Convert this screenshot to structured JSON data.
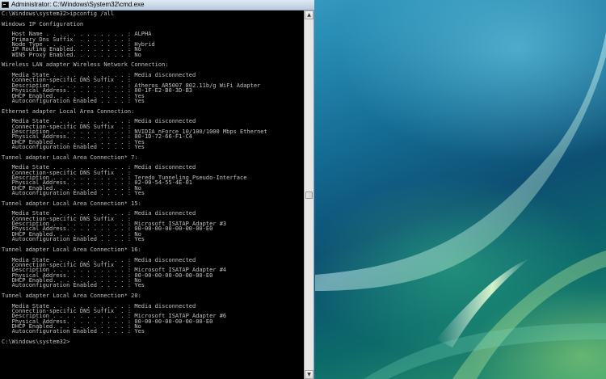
{
  "window": {
    "title": "Administrator: C:\\Windows\\System32\\cmd.exe"
  },
  "console": {
    "lines": [
      "C:\\Windows\\system32>ipconfig /all",
      "",
      "Windows IP Configuration",
      "",
      "   Host Name . . . . . . . . . . . . : ALPHA",
      "   Primary Dns Suffix  . . . . . . . :",
      "   Node Type . . . . . . . . . . . . : Hybrid",
      "   IP Routing Enabled. . . . . . . . : No",
      "   WINS Proxy Enabled. . . . . . . . : No",
      "",
      "Wireless LAN adapter Wireless Network Connection:",
      "",
      "   Media State . . . . . . . . . . . : Media disconnected",
      "   Connection-specific DNS Suffix  . :",
      "   Description . . . . . . . . . . . : Atheros AR5007 802.11b/g WiFi Adapter",
      "   Physical Address. . . . . . . . . : 00-1F-E2-B0-3D-B3",
      "   DHCP Enabled. . . . . . . . . . . : Yes",
      "   Autoconfiguration Enabled . . . . : Yes",
      "",
      "Ethernet adapter Local Area Connection:",
      "",
      "   Media State . . . . . . . . . . . : Media disconnected",
      "   Connection-specific DNS Suffix  . :",
      "   Description . . . . . . . . . . . : NVIDIA nForce 10/100/1000 Mbps Ethernet",
      "   Physical Address. . . . . . . . . : 00-1D-72-66-F1-C4",
      "   DHCP Enabled. . . . . . . . . . . : Yes",
      "   Autoconfiguration Enabled . . . . : Yes",
      "",
      "Tunnel adapter Local Area Connection* 7:",
      "",
      "   Media State . . . . . . . . . . . : Media disconnected",
      "   Connection-specific DNS Suffix  . :",
      "   Description . . . . . . . . . . . : Teredo Tunneling Pseudo-Interface",
      "   Physical Address. . . . . . . . . : 02-00-54-55-4E-01",
      "   DHCP Enabled. . . . . . . . . . . : No",
      "   Autoconfiguration Enabled . . . . : Yes",
      "",
      "Tunnel adapter Local Area Connection* 15:",
      "",
      "   Media State . . . . . . . . . . . : Media disconnected",
      "   Connection-specific DNS Suffix  . :",
      "   Description . . . . . . . . . . . : Microsoft ISATAP Adapter #3",
      "   Physical Address. . . . . . . . . : 00-00-00-00-00-00-00-E0",
      "   DHCP Enabled. . . . . . . . . . . : No",
      "   Autoconfiguration Enabled . . . . : Yes",
      "",
      "Tunnel adapter Local Area Connection* 16:",
      "",
      "   Media State . . . . . . . . . . . : Media disconnected",
      "   Connection-specific DNS Suffix  . :",
      "   Description . . . . . . . . . . . : Microsoft ISATAP Adapter #4",
      "   Physical Address. . . . . . . . . : 00-00-00-00-00-00-00-E0",
      "   DHCP Enabled. . . . . . . . . . . : No",
      "   Autoconfiguration Enabled . . . . : Yes",
      "",
      "Tunnel adapter Local Area Connection* 20:",
      "",
      "   Media State . . . . . . . . . . . : Media disconnected",
      "   Connection-specific DNS Suffix  . :",
      "   Description . . . . . . . . . . . : Microsoft ISATAP Adapter #6",
      "   Physical Address. . . . . . . . . : 00-00-00-00-00-00-00-E0",
      "   DHCP Enabled. . . . . . . . . . . : No",
      "   Autoconfiguration Enabled . . . . : Yes",
      "",
      "C:\\Windows\\system32>"
    ]
  },
  "icons": {
    "window_icon": "cmd-icon",
    "scroll_up": "chevron-up-icon",
    "scroll_down": "chevron-down-icon"
  }
}
